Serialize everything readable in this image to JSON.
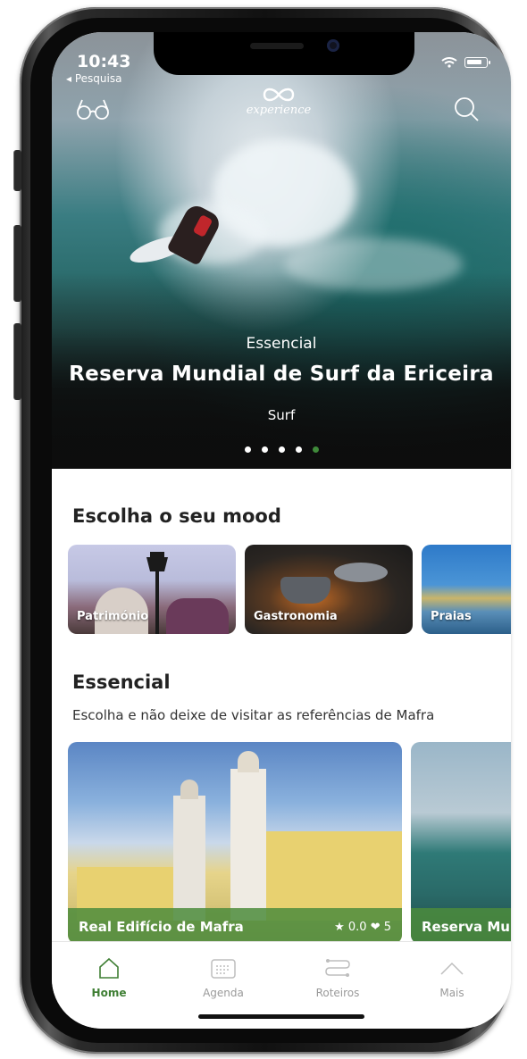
{
  "status_bar": {
    "time": "10:43",
    "back_label": "◂ Pesquisa"
  },
  "header": {
    "logo_text": "experience",
    "left_icon": "glasses-icon",
    "right_icon": "search-icon"
  },
  "hero": {
    "category": "Essencial",
    "title": "Reserva Mundial de Surf da Ericeira",
    "subtitle": "Surf",
    "pages": 5,
    "active_page": 5
  },
  "mood": {
    "title": "Escolha o seu mood",
    "items": [
      {
        "label": "Património"
      },
      {
        "label": "Gastronomia"
      },
      {
        "label": "Praias"
      }
    ]
  },
  "essencial": {
    "title": "Essencial",
    "description": "Escolha e não deixe de visitar as referências de Mafra",
    "cards": [
      {
        "name": "Real Edifício de Mafra",
        "rating": "★ 0.0",
        "likes": "❤ 5"
      },
      {
        "name": "Reserva Mu"
      }
    ]
  },
  "tabbar": {
    "items": [
      {
        "label": "Home",
        "icon": "home-icon"
      },
      {
        "label": "Agenda",
        "icon": "calendar-icon"
      },
      {
        "label": "Roteiros",
        "icon": "route-icon"
      },
      {
        "label": "Mais",
        "icon": "chevron-up-icon"
      }
    ],
    "active": "Home"
  },
  "colors": {
    "accent_green": "#3f7f34",
    "active_dot": "#3f8a3a"
  }
}
